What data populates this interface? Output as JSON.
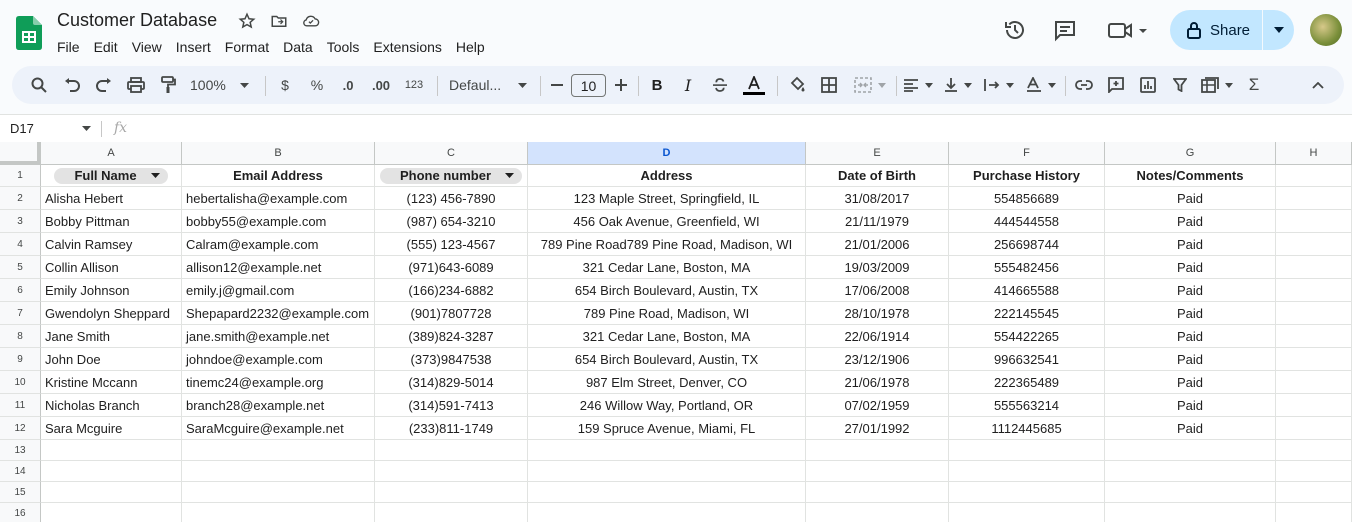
{
  "doc": {
    "title": "Customer Database"
  },
  "menu": [
    "File",
    "Edit",
    "View",
    "Insert",
    "Format",
    "Data",
    "Tools",
    "Extensions",
    "Help"
  ],
  "share": {
    "label": "Share"
  },
  "toolbar": {
    "zoom": "100%",
    "currency": "$",
    "percent": "%",
    "dec_decrease": ".0",
    "dec_increase": ".00",
    "number_format": "123",
    "font": "Defaul...",
    "font_size": "10"
  },
  "formula": {
    "name_box": "D17",
    "fx": "fx"
  },
  "columns": [
    "A",
    "B",
    "C",
    "D",
    "E",
    "F",
    "G",
    "H"
  ],
  "headers": [
    "Full Name",
    "Email Address",
    "Phone number",
    "Address",
    "Date of Birth",
    "Purchase History",
    "Notes/Comments"
  ],
  "rows": [
    [
      "Alisha Hebert",
      "hebertalisha@example.com",
      "(123) 456-7890",
      "123 Maple Street, Springfield, IL",
      "31/08/2017",
      "554856689",
      "Paid"
    ],
    [
      "Bobby Pittman",
      "bobby55@example.com",
      "(987) 654-3210",
      "456 Oak Avenue, Greenfield, WI",
      "21/11/1979",
      "444544558",
      "Paid"
    ],
    [
      "Calvin Ramsey",
      "Calram@example.com",
      "(555) 123-4567",
      "789 Pine Road789 Pine Road, Madison, WI",
      "21/01/2006",
      "256698744",
      "Paid"
    ],
    [
      "Collin Allison",
      "allison12@example.net",
      "(971)643-6089",
      "321 Cedar Lane, Boston, MA",
      "19/03/2009",
      "555482456",
      "Paid"
    ],
    [
      "Emily Johnson",
      "emily.j@gmail.com",
      "(166)234-6882",
      "654 Birch Boulevard, Austin, TX",
      "17/06/2008",
      "414665588",
      "Paid"
    ],
    [
      "Gwendolyn Sheppard",
      "Shepapard2232@example.com",
      "(901)7807728",
      "789 Pine Road, Madison, WI",
      "28/10/1978",
      "222145545",
      "Paid"
    ],
    [
      "Jane Smith",
      "jane.smith@example.net",
      "(389)824-3287",
      "321 Cedar Lane, Boston, MA",
      "22/06/1914",
      "554422265",
      "Paid"
    ],
    [
      "John Doe",
      "johndoe@example.com",
      "(373)9847538",
      "654 Birch Boulevard, Austin, TX",
      "23/12/1906",
      "996632541",
      "Paid"
    ],
    [
      "Kristine Mccann",
      "tinemc24@example.org",
      "(314)829-5014",
      "987 Elm Street, Denver, CO",
      "21/06/1978",
      "222365489",
      "Paid"
    ],
    [
      "Nicholas Branch",
      "branch28@example.net",
      "(314)591-7413",
      "246 Willow Way, Portland, OR",
      "07/02/1959",
      "555563214",
      "Paid"
    ],
    [
      "Sara Mcguire",
      "SaraMcguire@example.net",
      "(233)811-1749",
      "159 Spruce Avenue, Miami, FL",
      "27/01/1992",
      "1112445685",
      "Paid"
    ]
  ],
  "row_numbers": [
    "1",
    "2",
    "3",
    "4",
    "5",
    "6",
    "7",
    "8",
    "9",
    "10",
    "11",
    "12",
    "13",
    "14",
    "15",
    "16"
  ]
}
